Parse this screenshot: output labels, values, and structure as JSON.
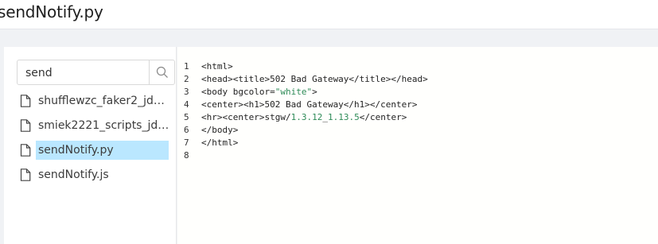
{
  "header": {
    "title": "sendNotify.py"
  },
  "search": {
    "value": "send",
    "placeholder": ""
  },
  "files": [
    {
      "label": "shufflewzc_faker2_jd_se...",
      "selected": false
    },
    {
      "label": "smiek2221_scripts_jd_se...",
      "selected": false
    },
    {
      "label": "sendNotify.py",
      "selected": true
    },
    {
      "label": "sendNotify.js",
      "selected": false
    }
  ],
  "editor": {
    "line_numbers": [
      "1",
      "2",
      "3",
      "4",
      "5",
      "6",
      "7",
      "8"
    ],
    "lines": {
      "l1": "<html>",
      "l2": "<head><title>502 Bad Gateway</title></head>",
      "l3a": "<body bgcolor=",
      "l3b": "\"white\"",
      "l3c": ">",
      "l4": "<center><h1>502 Bad Gateway</h1></center>",
      "l5a": "<hr><center>stgw/",
      "l5b": "1.3.12",
      "l5c": "_",
      "l5d": "1.13.5",
      "l5e": "</center>",
      "l6": "</body>",
      "l7": "</html>",
      "l8": ""
    }
  },
  "colors": {
    "selected_bg": "#bae7ff",
    "string": "#2e8b57",
    "header_bg": "#ffffff",
    "page_bg": "#f0f2f5"
  }
}
